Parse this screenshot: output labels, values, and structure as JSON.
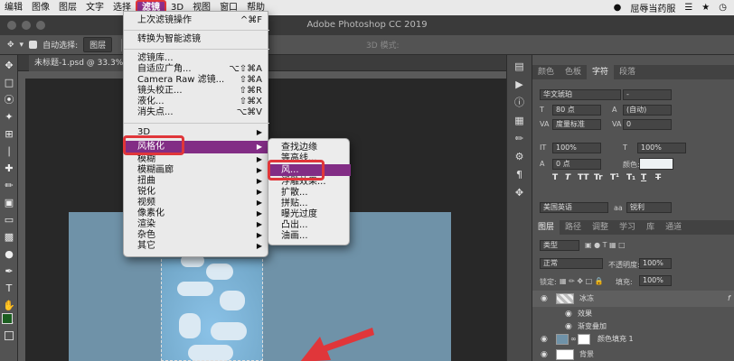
{
  "menubar": {
    "items": [
      "编辑",
      "图像",
      "图层",
      "文字",
      "选择",
      "滤镜",
      "3D",
      "视图",
      "窗口",
      "帮助"
    ],
    "active": "滤镜",
    "right_label": "屈辱当药服"
  },
  "window": {
    "title": "Adobe Photoshop CC 2019"
  },
  "options": {
    "auto_select": "自动选择:",
    "target": "图层",
    "three_d": "3D 模式:"
  },
  "document": {
    "tab_title": "未标题-1.psd @ 33.3% (冰冻"
  },
  "filter_menu": {
    "items": [
      {
        "label": "上次滤镜操作",
        "shortcut": "^⌘F"
      },
      {
        "label": "转换为智能滤镜",
        "shortcut": ""
      },
      {
        "label": "滤镜库...",
        "shortcut": ""
      },
      {
        "label": "自适应广角...",
        "shortcut": "⌥⇧⌘A"
      },
      {
        "label": "Camera Raw 滤镜...",
        "shortcut": "⇧⌘A"
      },
      {
        "label": "镜头校正...",
        "shortcut": "⇧⌘R"
      },
      {
        "label": "液化...",
        "shortcut": "⇧⌘X"
      },
      {
        "label": "消失点...",
        "shortcut": "⌥⌘V"
      },
      {
        "label": "3D",
        "shortcut": ""
      },
      {
        "label": "风格化",
        "shortcut": ""
      },
      {
        "label": "模糊",
        "shortcut": ""
      },
      {
        "label": "模糊画廊",
        "shortcut": ""
      },
      {
        "label": "扭曲",
        "shortcut": ""
      },
      {
        "label": "锐化",
        "shortcut": ""
      },
      {
        "label": "视频",
        "shortcut": ""
      },
      {
        "label": "像素化",
        "shortcut": ""
      },
      {
        "label": "渲染",
        "shortcut": ""
      },
      {
        "label": "杂色",
        "shortcut": ""
      },
      {
        "label": "其它",
        "shortcut": ""
      }
    ],
    "highlighted": "风格化"
  },
  "stylize_submenu": {
    "items": [
      "查找边缘",
      "等高线...",
      "风...",
      "浮雕效果...",
      "扩散...",
      "拼贴...",
      "曝光过度",
      "凸出...",
      "油画..."
    ],
    "highlighted": "风..."
  },
  "character_panel": {
    "tabs": [
      "颜色",
      "色板",
      "字符",
      "段落"
    ],
    "active_tab": "字符",
    "font_family": "华文琥珀",
    "font_style": "-",
    "size": "80 点",
    "leading": "(自动)",
    "kerning": "度量标准",
    "tracking": "0",
    "vscale": "100%",
    "hscale": "100%",
    "baseline": "0 点",
    "color_label": "颜色:",
    "type_buttons": [
      "T",
      "T",
      "TT",
      "Tr",
      "T¹",
      "T₁",
      "T",
      "T"
    ],
    "language": "美国英语",
    "antialias_label": "aa",
    "antialias": "锐利"
  },
  "layers_panel": {
    "tabs": [
      "图层",
      "路径",
      "调整",
      "学习",
      "库",
      "通道"
    ],
    "active_tab": "图层",
    "filter_kind": "类型",
    "blend_mode": "正常",
    "opacity_label": "不透明度:",
    "opacity": "100%",
    "lock_label": "锁定:",
    "fill_label": "填充:",
    "fill": "100%",
    "layers": [
      {
        "name": "冰冻",
        "type": "text"
      },
      {
        "name": "效果",
        "type": "effect"
      },
      {
        "name": "渐变叠加",
        "type": "effect"
      },
      {
        "name": "颜色填充 1",
        "type": "fill"
      },
      {
        "name": "背景",
        "type": "bg"
      }
    ]
  },
  "colors": {
    "accent": "#822d85",
    "annotation_red": "#e0363a",
    "foreground": "#1b5e20"
  }
}
